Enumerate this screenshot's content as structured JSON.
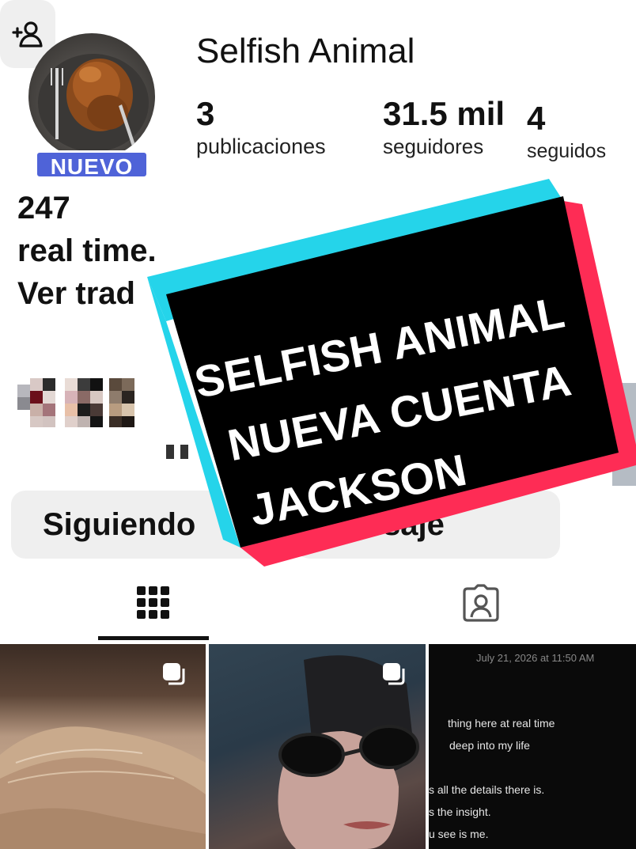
{
  "profile": {
    "username": "Selfish Animal",
    "badge": "NUEVO",
    "stats": {
      "posts_count": "3",
      "posts_label": "publicaciones",
      "followers_count": "31.5 mil",
      "followers_label": "seguidores",
      "following_count": "4",
      "following_label": "seguidos"
    },
    "bio_lines": [
      "247",
      "real time.",
      "Ver trad"
    ]
  },
  "buttons": {
    "following": "Siguiendo",
    "message": "Mensaje"
  },
  "icons": {
    "add_user": "add-user-icon",
    "grid": "grid-icon",
    "tagged": "tagged-icon",
    "multi_post": "multi-post-icon"
  },
  "posts": {
    "note": {
      "date": "July 21, 2026 at 11:50 AM",
      "lines": [
        "thing here at real time",
        "deep into my life",
        "s all the details there is.",
        "s the insight.",
        "u see is me."
      ]
    }
  },
  "overlay": {
    "lines": [
      "SELFISH ANIMAL",
      "NUEVA CUENTA",
      "JACKSON"
    ],
    "colors": {
      "cyan": "#25d4ea",
      "red": "#fe2c55",
      "black": "#000000"
    }
  }
}
